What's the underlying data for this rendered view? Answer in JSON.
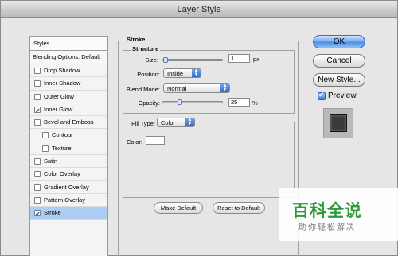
{
  "window": {
    "title": "Layer Style"
  },
  "sidebar": {
    "header": "Styles",
    "blending_options": "Blending Options: Default",
    "items": [
      {
        "label": "Drop Shadow",
        "checked": false,
        "indent": false,
        "has_checkbox": true
      },
      {
        "label": "Inner Shadow",
        "checked": false,
        "indent": false,
        "has_checkbox": true
      },
      {
        "label": "Outer Glow",
        "checked": false,
        "indent": false,
        "has_checkbox": true
      },
      {
        "label": "Inner Glow",
        "checked": true,
        "indent": false,
        "has_checkbox": true
      },
      {
        "label": "Bevel and Emboss",
        "checked": false,
        "indent": false,
        "has_checkbox": true
      },
      {
        "label": "Contour",
        "checked": false,
        "indent": true,
        "has_checkbox": true
      },
      {
        "label": "Texture",
        "checked": false,
        "indent": true,
        "has_checkbox": true
      },
      {
        "label": "Satin",
        "checked": false,
        "indent": false,
        "has_checkbox": true
      },
      {
        "label": "Color Overlay",
        "checked": false,
        "indent": false,
        "has_checkbox": true
      },
      {
        "label": "Gradient Overlay",
        "checked": false,
        "indent": false,
        "has_checkbox": true
      },
      {
        "label": "Pattern Overlay",
        "checked": false,
        "indent": false,
        "has_checkbox": true
      },
      {
        "label": "Stroke",
        "checked": true,
        "indent": false,
        "has_checkbox": true,
        "selected": true
      }
    ]
  },
  "stroke": {
    "group_label": "Stroke",
    "structure": {
      "label": "Structure",
      "size_label": "Size:",
      "size_value": "1",
      "size_unit": "px",
      "position_label": "Position:",
      "position_value": "Inside",
      "blend_label": "Blend Mode:",
      "blend_value": "Normal",
      "opacity_label": "Opacity:",
      "opacity_value": "25",
      "opacity_unit": "%"
    },
    "fill": {
      "type_label": "Fill Type:",
      "type_value": "Color",
      "color_label": "Color:"
    },
    "make_default": "Make Default",
    "reset_default": "Reset to Default"
  },
  "buttons": {
    "ok": "OK",
    "cancel": "Cancel",
    "new_style": "New Style...",
    "preview_label": "Preview"
  },
  "watermark": {
    "title": "百科全说",
    "subtitle": "助你轻松解决"
  }
}
